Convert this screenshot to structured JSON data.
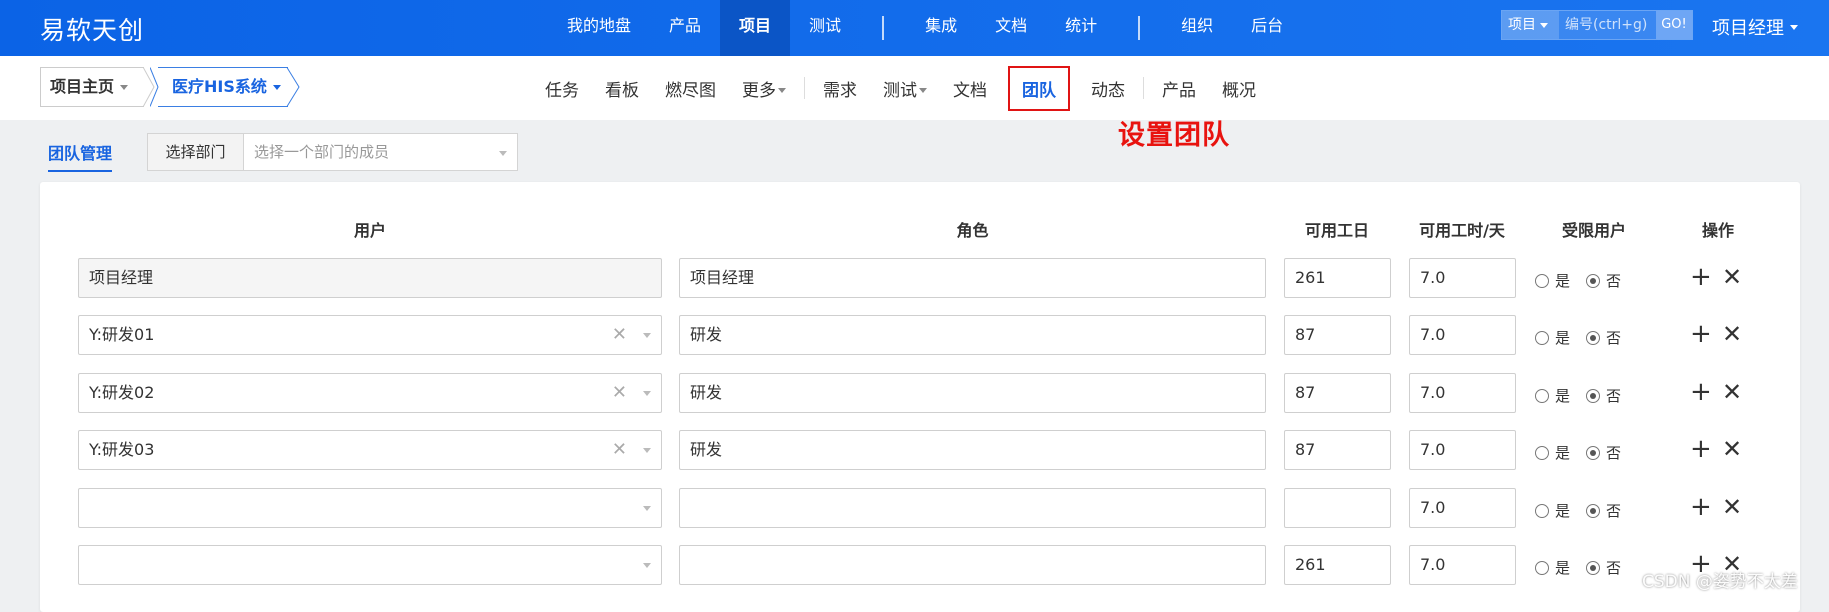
{
  "app": {
    "brand": "易软天创"
  },
  "main_nav": {
    "items": [
      "我的地盘",
      "产品",
      "项目",
      "测试",
      "集成",
      "文档",
      "统计",
      "组织",
      "后台"
    ],
    "active": "项目"
  },
  "search": {
    "type_label": "项目",
    "placeholder": "编号(ctrl+g)",
    "go_label": "GO!"
  },
  "user": {
    "name": "项目经理"
  },
  "breadcrumb": {
    "home": "项目主页",
    "project": "医疗HIS系统"
  },
  "sub_nav": {
    "items": [
      "任务",
      "看板",
      "燃尽图",
      "更多",
      "需求",
      "测试",
      "文档",
      "团队",
      "动态",
      "产品",
      "概况"
    ],
    "active": "团队"
  },
  "annotation": "设置团队",
  "toolbar": {
    "tab_label": "团队管理",
    "dept_label": "选择部门",
    "dept_placeholder": "选择一个部门的成员"
  },
  "table": {
    "headers": {
      "user": "用户",
      "role": "角色",
      "days": "可用工日",
      "hours": "可用工时/天",
      "limited": "受限用户",
      "actions": "操作"
    },
    "yes_label": "是",
    "no_label": "否",
    "rows": [
      {
        "user": "项目经理",
        "role": "项目经理",
        "days": "261",
        "hours": "7.0",
        "limited": "no",
        "readonly": true
      },
      {
        "user": "Y:研发01",
        "role": "研发",
        "days": "87",
        "hours": "7.0",
        "limited": "no"
      },
      {
        "user": "Y:研发02",
        "role": "研发",
        "days": "87",
        "hours": "7.0",
        "limited": "no"
      },
      {
        "user": "Y:研发03",
        "role": "研发",
        "days": "87",
        "hours": "7.0",
        "limited": "no"
      },
      {
        "user": "",
        "role": "",
        "days": "",
        "hours": "7.0",
        "limited": "no"
      },
      {
        "user": "",
        "role": "",
        "days": "261",
        "hours": "7.0",
        "limited": "no"
      }
    ]
  },
  "watermark": "CSDN @姿势不太差"
}
